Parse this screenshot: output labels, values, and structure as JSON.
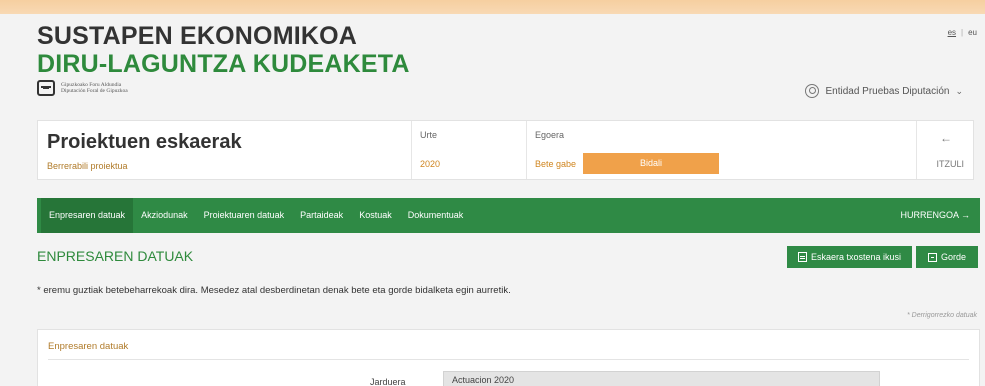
{
  "header": {
    "title_line1": "SUSTAPEN EKONOMIKOA",
    "title_line2": "DIRU-LAGUNTZA KUDEAKETA",
    "logo_line1": "Gipuzkoako Foru Aldundia",
    "logo_line2": "Diputación Foral de Gipuzkoa",
    "lang_es": "es",
    "lang_eu": "eu",
    "user_name": "Entidad Pruebas Diputación",
    "user_caret": "⌄"
  },
  "project": {
    "title": "Proiektuen eskaerak",
    "subtitle": "Berrerabili proiektua",
    "year_label": "Urte",
    "year_value": "2020",
    "status_label": "Egoera",
    "status_value": "Bete gabe",
    "send_label": "Bidali",
    "back_arrow": "←",
    "back_label": "ITZULI"
  },
  "tabs": [
    {
      "label": "Enpresaren datuak"
    },
    {
      "label": "Akziodunak"
    },
    {
      "label": "Proiektuaren datuak"
    },
    {
      "label": "Partaideak"
    },
    {
      "label": "Kostuak"
    },
    {
      "label": "Dokumentuak"
    }
  ],
  "next_label": "HURRENGOA →",
  "section": {
    "title": "ENPRESAREN DATUAK",
    "pdf_label": "Eskaera txostena ikusi",
    "save_label": "Gorde",
    "notice": "* eremu guztiak betebeharrekoak dira. Mesedez atal desberdinetan denak bete eta gorde bidalketa egin aurretik.",
    "required_note": "* Derrigorrezko datuak"
  },
  "form": {
    "card_title": "Enpresaren datuak",
    "activity_label": "Jarduera",
    "activity_value": "Actuacion 2020"
  },
  "colors": {
    "green": "#2f8a45",
    "title_green": "#2e8a3c",
    "orange": "#f0a14a",
    "amber_text": "#d08620"
  }
}
